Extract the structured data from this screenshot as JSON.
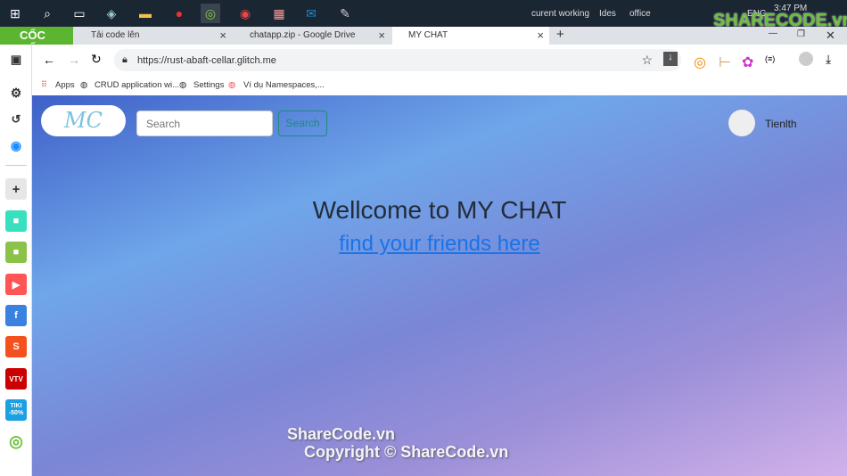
{
  "taskbar": {
    "groups": [
      "curent working",
      "Ides",
      "office"
    ],
    "lang": "ENG",
    "time": "3:47 PM"
  },
  "watermark": {
    "logo": "SHARECODE.vn",
    "line1": "ShareCode.vn",
    "line2": "Copyright © ShareCode.vn"
  },
  "browser": {
    "brand": "CỐC CỐC",
    "tabs": [
      {
        "label": "Tải code lên"
      },
      {
        "label": "chatapp.zip - Google Drive"
      },
      {
        "label": "MY CHAT"
      }
    ],
    "url": "https://rust-abaft-cellar.glitch.me",
    "bookmarks": [
      "Apps",
      "CRUD application wi...",
      "Settings",
      "Ví dụ Namespaces,..."
    ]
  },
  "sidebar": {
    "apps": [
      {
        "icon": "tiki",
        "label": "TIKI -50%"
      }
    ]
  },
  "app": {
    "logo": "MC",
    "search_placeholder": "Search",
    "search_button": "Search",
    "username": "Tienlth",
    "welcome": "Wellcome to MY CHAT",
    "link": "find your friends here"
  }
}
